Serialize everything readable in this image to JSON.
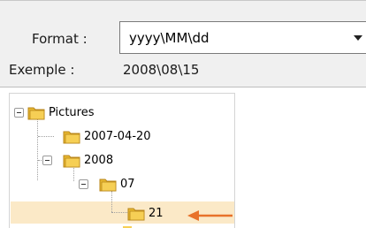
{
  "format": {
    "label": "Format :",
    "value": "yyyy\\MM\\dd"
  },
  "example": {
    "label": "Exemple :",
    "value": "2008\\08\\15"
  },
  "tree": {
    "nodes": [
      {
        "label": "Pictures",
        "icon": "folder-icon",
        "expanded": true
      },
      {
        "label": "2007-04-20",
        "icon": "folder-icon"
      },
      {
        "label": "2008",
        "icon": "folder-icon",
        "expanded": true
      },
      {
        "label": "07",
        "icon": "folder-icon",
        "expanded": true
      },
      {
        "label": "21",
        "icon": "folder-icon",
        "selected": true
      }
    ]
  },
  "colors": {
    "selection": "#fbe9c7",
    "arrow": "#e8722a",
    "folder": "#e8b830"
  }
}
